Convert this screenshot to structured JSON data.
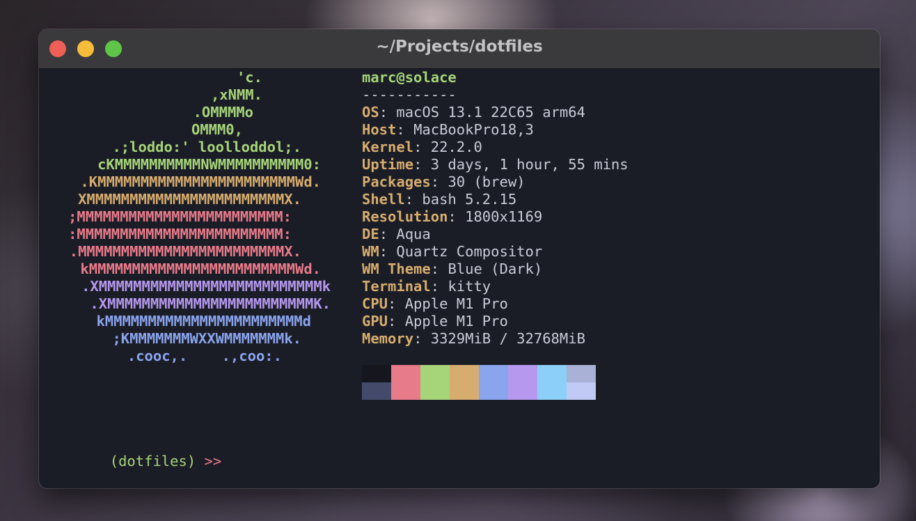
{
  "window": {
    "title": "~/Projects/dotfiles"
  },
  "logo": {
    "lines": [
      {
        "text": "'c.",
        "color": "#a6d479"
      },
      {
        "text": ",xNMM.",
        "color": "#a6d479"
      },
      {
        "text": ".OMMMMo",
        "color": "#a6d479"
      },
      {
        "text": "OMMM0,",
        "color": "#a6d479"
      },
      {
        "text": ".;loddo:' loolloddol;.",
        "color": "#a6d479"
      },
      {
        "text": "cKMMMMMMMMMMNWMMMMMMMMMM0:",
        "color": "#a6d479"
      },
      {
        "text": ".KMMMMMMMMMMMMMMMMMMMMMMMWd.",
        "color": "#d7ad6f"
      },
      {
        "text": "XMMMMMMMMMMMMMMMMMMMMMMMX.",
        "color": "#d7ad6f"
      },
      {
        "text": ";MMMMMMMMMMMMMMMMMMMMMMMM:",
        "color": "#e87b8a"
      },
      {
        "text": ":MMMMMMMMMMMMMMMMMMMMMMMM:",
        "color": "#e87b8a"
      },
      {
        "text": ".MMMMMMMMMMMMMMMMMMMMMMMMX.",
        "color": "#e87b8a"
      },
      {
        "text": "kMMMMMMMMMMMMMMMMMMMMMMMMWd.",
        "color": "#e87b8a"
      },
      {
        "text": ".XMMMMMMMMMMMMMMMMMMMMMMMMMMk",
        "color": "#b699ef"
      },
      {
        "text": ".XMMMMMMMMMMMMMMMMMMMMMMMMK.",
        "color": "#b699ef"
      },
      {
        "text": "kMMMMMMMMMMMMMMMMMMMMMMMd",
        "color": "#8aa4ee"
      },
      {
        "text": ";KMMMMMMMWXXWMMMMMMMk.",
        "color": "#8aa4ee"
      },
      {
        "text": ".cooc,.    .,coo:.",
        "color": "#8aa4ee"
      }
    ]
  },
  "info": {
    "userhost": "marc@solace",
    "separator": "-----------",
    "rows": [
      {
        "key": "OS",
        "value": "macOS 13.1 22C65 arm64"
      },
      {
        "key": "Host",
        "value": "MacBookPro18,3"
      },
      {
        "key": "Kernel",
        "value": "22.2.0"
      },
      {
        "key": "Uptime",
        "value": "3 days, 1 hour, 55 mins"
      },
      {
        "key": "Packages",
        "value": "30 (brew)"
      },
      {
        "key": "Shell",
        "value": "bash 5.2.15"
      },
      {
        "key": "Resolution",
        "value": "1800x1169"
      },
      {
        "key": "DE",
        "value": "Aqua"
      },
      {
        "key": "WM",
        "value": "Quartz Compositor"
      },
      {
        "key": "WM Theme",
        "value": "Blue (Dark)"
      },
      {
        "key": "Terminal",
        "value": "kitty"
      },
      {
        "key": "CPU",
        "value": "Apple M1 Pro"
      },
      {
        "key": "GPU",
        "value": "Apple M1 Pro"
      },
      {
        "key": "Memory",
        "value": "3329MiB / 32768MiB"
      }
    ],
    "key_separator": ": "
  },
  "palette": {
    "normal": [
      "#15161e",
      "#e87b8a",
      "#a6d479",
      "#d7ad6f",
      "#8aa4ee",
      "#b699ef",
      "#8ccff8",
      "#a9b1d6"
    ],
    "bright": [
      "#444b6a",
      "#e87b8a",
      "#a6d479",
      "#d7ad6f",
      "#8aa4ee",
      "#b699ef",
      "#8ccff8",
      "#c0caf5"
    ]
  },
  "prompt": {
    "env": "(dotfiles)",
    "arrow": ">>"
  }
}
